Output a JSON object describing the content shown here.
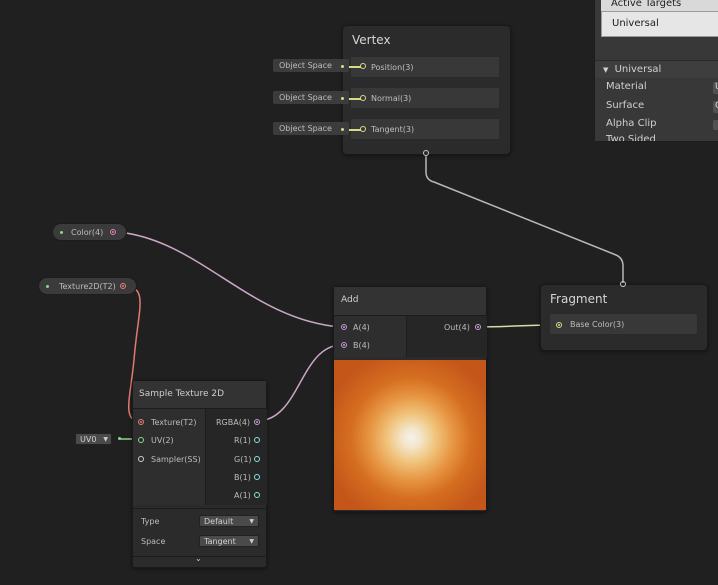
{
  "inspector": {
    "active_targets_label": "Active Targets",
    "target_item": "Universal",
    "section_title": "Universal",
    "properties": [
      {
        "label": "Material",
        "value": "U"
      },
      {
        "label": "Surface",
        "value": "O"
      },
      {
        "label": "Alpha Clip",
        "value": ""
      },
      {
        "label": "Two Sided",
        "value": ""
      }
    ]
  },
  "vertex": {
    "title": "Vertex",
    "slots": [
      {
        "label": "Position(3)",
        "input": "Object Space"
      },
      {
        "label": "Normal(3)",
        "input": "Object Space"
      },
      {
        "label": "Tangent(3)",
        "input": "Object Space"
      }
    ]
  },
  "fragment": {
    "title": "Fragment",
    "slots": [
      {
        "label": "Base Color(3)"
      }
    ]
  },
  "color_property": {
    "label": "Color(4)"
  },
  "texture_property": {
    "label": "Texture2D(T2)"
  },
  "add_node": {
    "title": "Add",
    "inputs": [
      "A(4)",
      "B(4)"
    ],
    "output": "Out(4)"
  },
  "sample_node": {
    "title": "Sample Texture 2D",
    "inputs": [
      "Texture(T2)",
      "UV(2)",
      "Sampler(SS)"
    ],
    "outputs": [
      "RGBA(4)",
      "R(1)",
      "G(1)",
      "B(1)",
      "A(1)"
    ],
    "uv_field": "UV0",
    "type_label": "Type",
    "type_value": "Default",
    "space_label": "Space",
    "space_value": "Tangent"
  },
  "colors": {
    "background": "#202020",
    "vector4_port": "#c79bd6",
    "vector3_port": "#d8dc8a",
    "vector2_port": "#8cd48c",
    "vector1_port": "#84e4e7",
    "texture_port": "#e87e74",
    "vertex_edge": "#b4b4b4"
  }
}
